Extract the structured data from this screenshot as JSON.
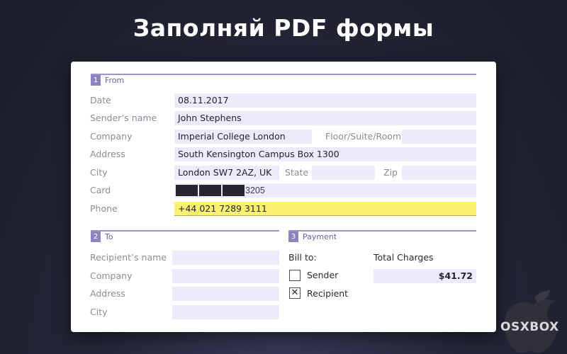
{
  "headline": "Заполняй PDF формы",
  "from": {
    "number": "1",
    "title": "From",
    "date_label": "Date",
    "date_value": "08.11.2017",
    "sender_label": "Sender’s name",
    "sender_value": "John Stephens",
    "company_label": "Company",
    "company_value": "Imperial College London",
    "floor_label": "Floor/Suite/Room",
    "floor_value": "",
    "address_label": "Address",
    "address_value": "South Kensington Campus Box 1300",
    "city_label": "City",
    "city_value": "London SW7 2AZ, UK",
    "state_label": "State",
    "state_value": "",
    "zip_label": "Zip",
    "zip_value": "",
    "card_label": "Card",
    "card_last4": "3205",
    "phone_label": "Phone",
    "phone_value": "+44 021 7289 3111"
  },
  "to": {
    "number": "2",
    "title": "To",
    "recipient_label": "Recipient’s name",
    "recipient_value": "",
    "company_label": "Company",
    "company_value": "",
    "address_label": "Address",
    "address_value": "",
    "city_label": "City",
    "city_value": ""
  },
  "payment": {
    "number": "3",
    "title": "Payment",
    "bill_to_label": "Bill to:",
    "total_label": "Total  Charges",
    "total_value": "$41.72",
    "sender_option": "Sender",
    "sender_checked": false,
    "recipient_option": "Recipient",
    "recipient_checked": true,
    "check_mark": "✕"
  },
  "watermark": {
    "text": "OSXBOX"
  },
  "colors": {
    "accent": "#8e83bd",
    "field_bg": "#ecebfb",
    "highlight": "#fcf272",
    "background": "#252638"
  }
}
